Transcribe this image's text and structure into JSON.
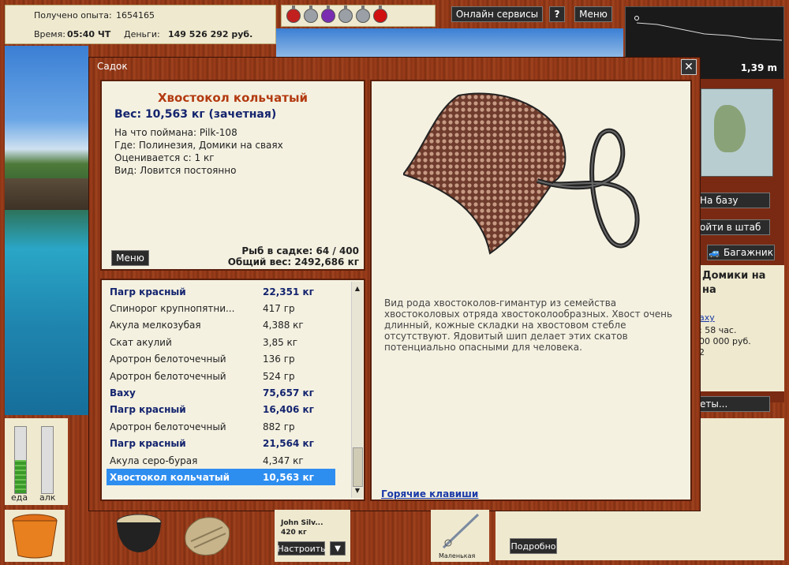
{
  "top": {
    "xp_label": "Получено опыта:",
    "xp_value": "1654165",
    "time_label": "Время:",
    "time_value": "05:40 ЧТ",
    "money_label": "Деньги:",
    "money_value": "149 526 292 руб.",
    "online_label": "Онлайн сервисы",
    "help_label": "?",
    "menu_label": "Меню",
    "potion_colors": [
      "#c2201e",
      "#9aa0a6",
      "#7a2db0",
      "#9aa0a6",
      "#9aa0a6",
      "#d01010"
    ]
  },
  "minimap": {
    "depth": "1,39 m"
  },
  "right_panel": {
    "base_btn": "На базу",
    "hq_btn": "ойти в штаб",
    "trunk_btn": "Багажник",
    "location": "Домики на",
    "location2": "на",
    "link": "аху",
    "time_left": ": 58 час.",
    "price": "00 000 руб.",
    "num": "2",
    "more_btn": "еты..."
  },
  "dialog": {
    "title": "Садок",
    "close_label": "✕"
  },
  "info": {
    "fish_name": "Хвостокол кольчатый",
    "weight_line": "Вес: 10,563 кг (зачетная)",
    "caught_on": "На что поймана: Pilk-108",
    "where": "Где: Полинезия, Домики на сваях",
    "valued_from": "Оценивается с: 1 кг",
    "kind": "Вид: Ловится постоянно",
    "menu_btn": "Меню",
    "fish_count": "Рыб в садке: 64 / 400",
    "total_weight": "Общий вес: 2492,686 кг"
  },
  "fish_list": [
    {
      "name": "Пагр красный",
      "weight": "22,351 кг",
      "trophy": true,
      "selected": false
    },
    {
      "name": "Спинорог крупнопятни...",
      "weight": "417 гр",
      "trophy": false,
      "selected": false
    },
    {
      "name": "Акула мелкозубая",
      "weight": "4,388 кг",
      "trophy": false,
      "selected": false
    },
    {
      "name": "Скат акулий",
      "weight": "3,85 кг",
      "trophy": false,
      "selected": false
    },
    {
      "name": "Аротрон белоточечный",
      "weight": "136 гр",
      "trophy": false,
      "selected": false
    },
    {
      "name": "Аротрон белоточечный",
      "weight": "524 гр",
      "trophy": false,
      "selected": false
    },
    {
      "name": "Baxy",
      "weight": "75,657 кг",
      "trophy": true,
      "selected": false
    },
    {
      "name": "Пагр красный",
      "weight": "16,406 кг",
      "trophy": true,
      "selected": false
    },
    {
      "name": "Аротрон белоточечный",
      "weight": "882 гр",
      "trophy": false,
      "selected": false
    },
    {
      "name": "Пагр красный",
      "weight": "21,564 кг",
      "trophy": true,
      "selected": false
    },
    {
      "name": "Акула серо-бурая",
      "weight": "4,347 кг",
      "trophy": false,
      "selected": false
    },
    {
      "name": "Хвостокол кольчатый",
      "weight": "10,563 кг",
      "trophy": true,
      "selected": true
    }
  ],
  "description": {
    "text": "Вид рода хвостоколов-гимантур из семейства хвостоколовых отряда хвостоколообразных. Хвост очень длинный, кожные складки на хвостовом стебле отсутствуют. Ядовитый шип делает этих скатов потенциально опасными для человека.",
    "hotkeys_link": "Горячие клавиши"
  },
  "bottom": {
    "food_label": "еда",
    "alc_label": "алк",
    "food_level": 0.5,
    "alc_level": 0,
    "bait_name": "John Silv...",
    "bait_weight": "420 кг",
    "setup_btn": "Настроить",
    "dropdown": "▼",
    "rod_label": "Маленькая",
    "details_btn": "Подробно"
  },
  "colors": {
    "trophy": "#14246e",
    "selected_bg": "#2e8ef0",
    "title_red": "#b33a10"
  }
}
